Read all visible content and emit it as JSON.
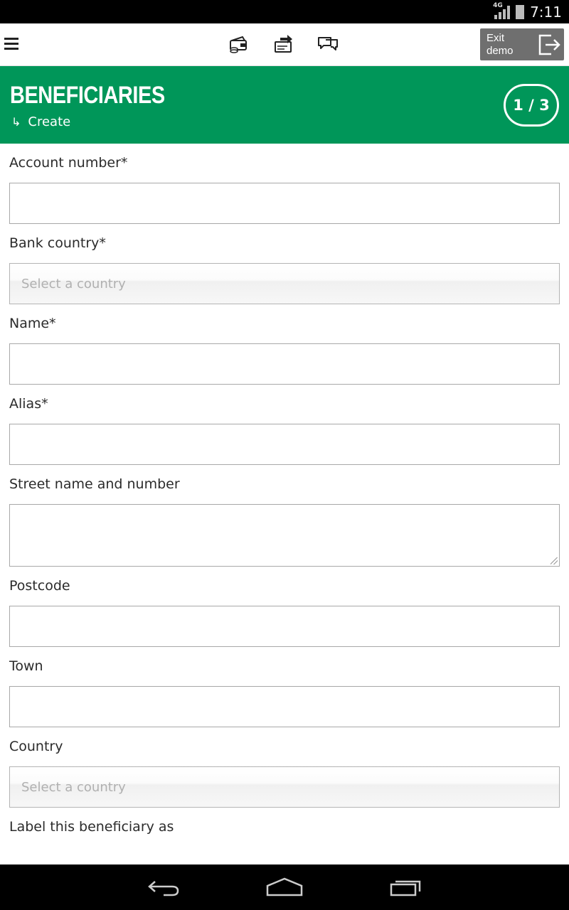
{
  "status_bar": {
    "network": "4G",
    "time": "7:11"
  },
  "toolbar": {
    "icons": [
      "wallet-icon",
      "transfer-icon",
      "chat-icon"
    ],
    "exit_demo_label": "Exit\ndemo"
  },
  "header": {
    "title": "BENEFICIARIES",
    "breadcrumb_arrow": "↳",
    "breadcrumb": "Create",
    "step": "1 / 3",
    "color": "#009659"
  },
  "form": {
    "account_number": {
      "label": "Account number*",
      "value": ""
    },
    "bank_country": {
      "label": "Bank country*",
      "placeholder": "Select a country"
    },
    "name": {
      "label": "Name*",
      "value": ""
    },
    "alias": {
      "label": "Alias*",
      "value": ""
    },
    "street": {
      "label": "Street name and number",
      "value": ""
    },
    "postcode": {
      "label": "Postcode",
      "value": ""
    },
    "town": {
      "label": "Town",
      "value": ""
    },
    "country": {
      "label": "Country",
      "placeholder": "Select a country"
    },
    "label_as": {
      "label": "Label this beneficiary as"
    }
  },
  "nav_bar": {
    "buttons": [
      "back-icon",
      "home-icon",
      "recents-icon"
    ]
  }
}
